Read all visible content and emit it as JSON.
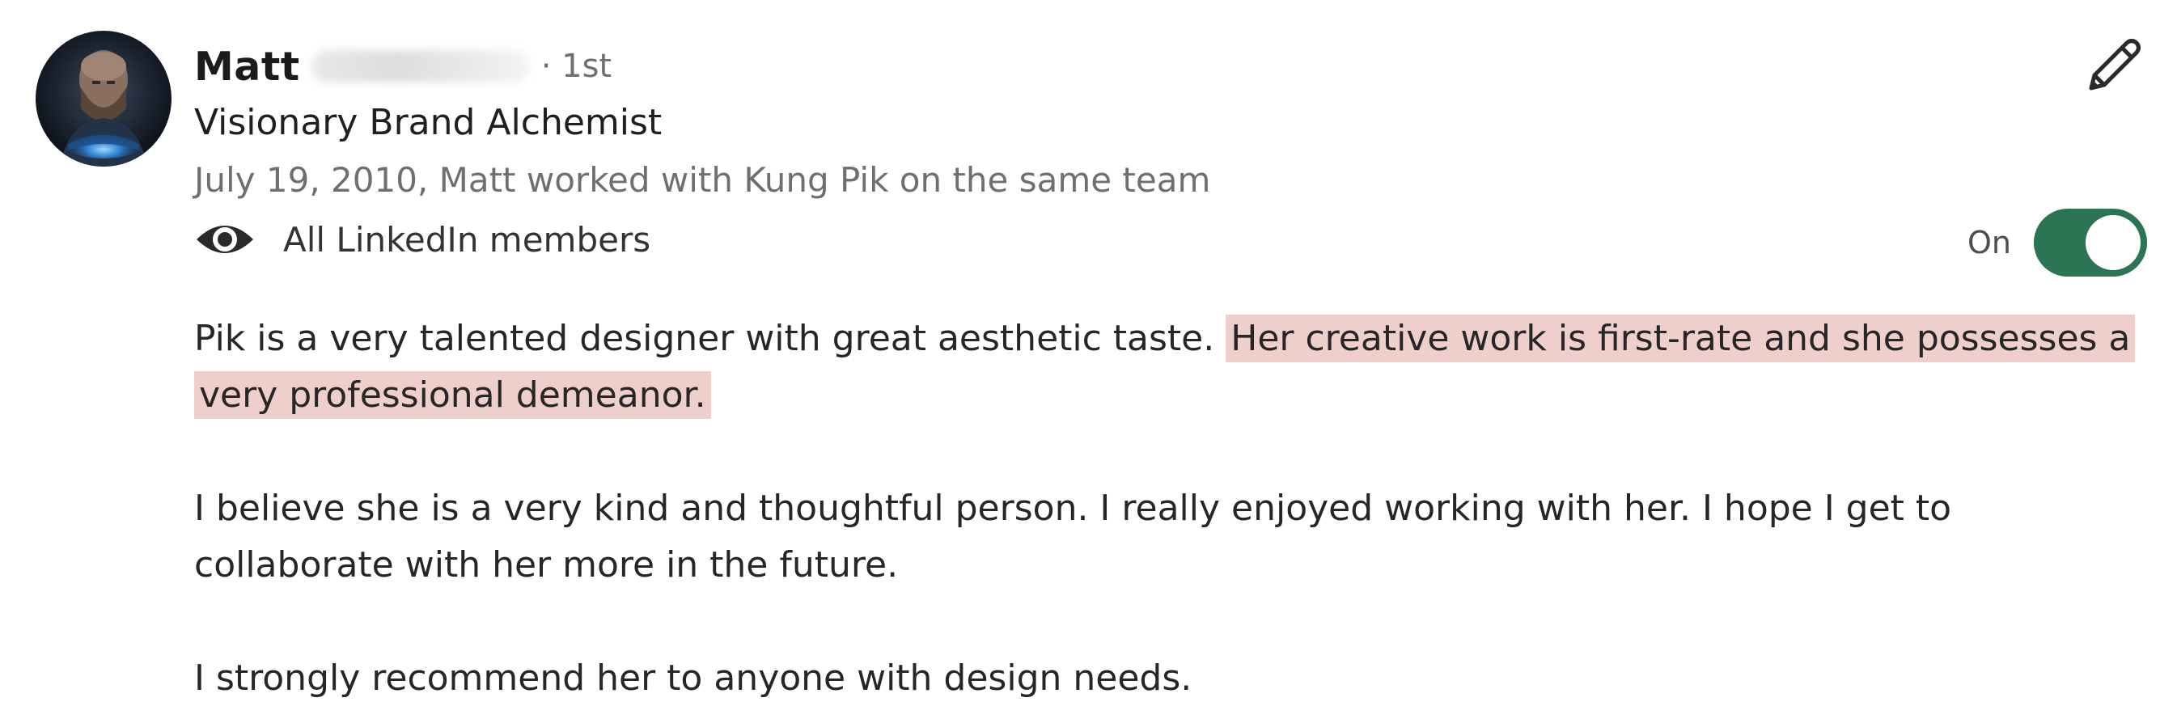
{
  "recommender": {
    "first_name": "Matt",
    "degree": "· 1st",
    "headline": "Visionary Brand Alchemist",
    "relationship": "July 19, 2010, Matt worked with Kung Pik on the same team"
  },
  "visibility": {
    "icon": "eye-icon",
    "label": "All LinkedIn members",
    "toggle_state_label": "On",
    "toggle_on": true
  },
  "recommendation": {
    "paragraph1_plain": "Pik is a very talented designer with great aesthetic taste. ",
    "paragraph1_highlight": "Her creative work is first-rate and she possesses a very professional demeanor.",
    "paragraph2": "I believe she is a very kind and thoughtful person. I really enjoyed working with her. I hope I get to collaborate with her more in the future.",
    "paragraph3": "I strongly recommend her to anyone with design needs."
  },
  "icons": {
    "edit": "pencil-icon",
    "visibility": "eye-icon"
  },
  "colors": {
    "toggle_on": "#2c7554",
    "highlight": "#efcfcc",
    "secondary_text": "#6f6f6f"
  }
}
